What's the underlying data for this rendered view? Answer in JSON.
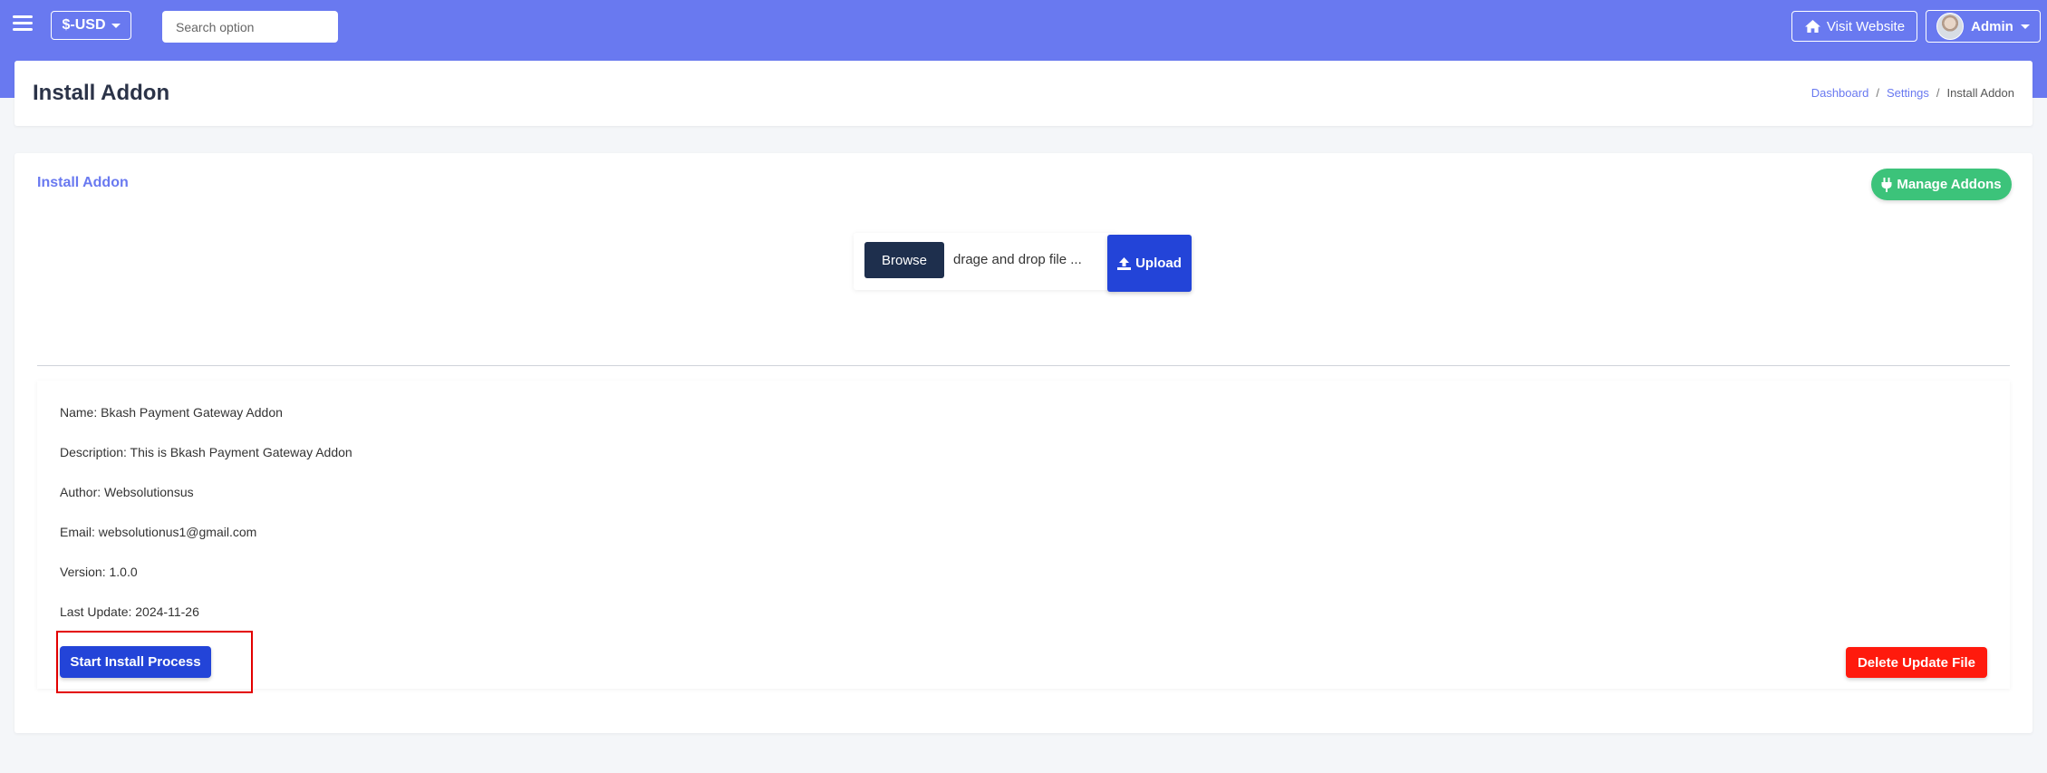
{
  "topbar": {
    "currency_label": "$-USD",
    "search_placeholder": "Search option",
    "visit_label": "Visit Website",
    "admin_label": "Admin",
    "background_color": "#6979f0"
  },
  "header": {
    "title": "Install Addon",
    "breadcrumb": [
      "Dashboard",
      "Settings",
      "Install Addon"
    ]
  },
  "card": {
    "title": "Install Addon",
    "manage_label": "Manage Addons",
    "browse_label": "Browse",
    "file_label": "drage and drop file ...",
    "upload_label": "Upload"
  },
  "addon_info": {
    "name": "Name: Bkash Payment Gateway Addon",
    "description": "Description: This is Bkash Payment Gateway Addon",
    "author": "Author: Websolutionsus",
    "email": "Email: websolutionus1@gmail.com",
    "version": "Version: 1.0.0",
    "last_update": "Last Update: 2024-11-26"
  },
  "actions": {
    "install_label": "Start Install Process",
    "delete_label": "Delete Update File"
  },
  "colors": {
    "primary": "#2344d8",
    "success": "#3cc37a",
    "danger": "#ff1a0d",
    "highlight": "#e30000"
  },
  "icons": [
    "menu-icon",
    "caret-down-icon",
    "home-icon",
    "plug-icon",
    "upload-icon"
  ]
}
